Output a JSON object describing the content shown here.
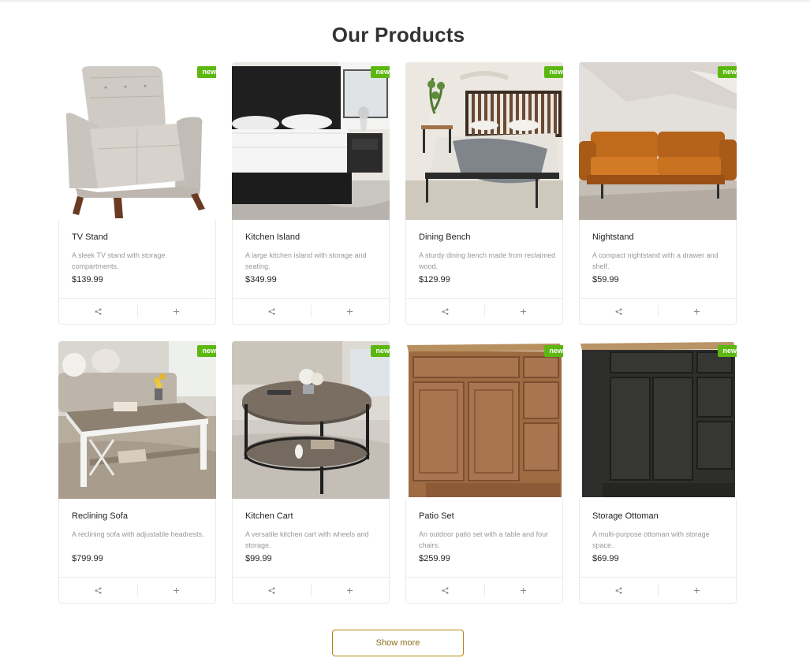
{
  "section_title": "Our Products",
  "badge_label": "new",
  "show_more_label": "Show more",
  "colors": {
    "badge": "#5cb811",
    "show_more_border": "#b8860b",
    "title": "#333333"
  },
  "products": [
    {
      "name": "TV Stand",
      "description": "A sleek TV stand with storage compartments.",
      "price": "$139.99",
      "image": "armchair"
    },
    {
      "name": "Kitchen Island",
      "description": "A large kitchen island with storage and seating.",
      "price": "$349.99",
      "image": "mattress-bed"
    },
    {
      "name": "Dining Bench",
      "description": "A sturdy dining bench made from reclaimed wood.",
      "price": "$129.99",
      "image": "bed-frame"
    },
    {
      "name": "Nightstand",
      "description": "A compact nightstand with a drawer and shelf.",
      "price": "$59.99",
      "image": "leather-sofa"
    },
    {
      "name": "Reclining Sofa",
      "description": "A reclining sofa with adjustable headrests.",
      "price": "$799.99",
      "image": "coffee-table"
    },
    {
      "name": "Kitchen Cart",
      "description": "A versatile kitchen cart with wheels and storage.",
      "price": "$99.99",
      "image": "round-table"
    },
    {
      "name": "Patio Set",
      "description": "An outdoor patio set with a table and four chairs.",
      "price": "$259.99",
      "image": "wood-cabinet"
    },
    {
      "name": "Storage Ottoman",
      "description": "A multi-purpose ottoman with storage space.",
      "price": "$69.99",
      "image": "dark-cabinet"
    }
  ]
}
